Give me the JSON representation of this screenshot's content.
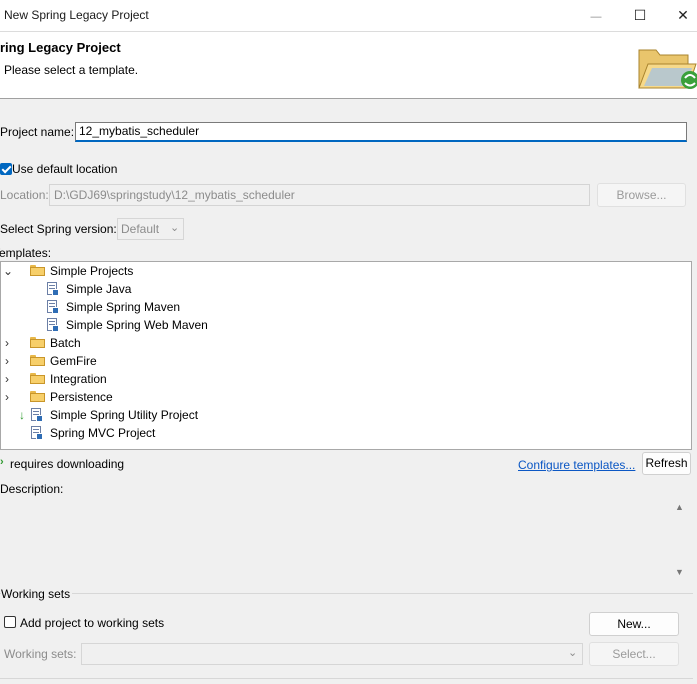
{
  "window": {
    "title": "New Spring Legacy Project",
    "minimize_glyph": "—",
    "maximize_glyph": "☐",
    "close_glyph": "✕"
  },
  "banner": {
    "title": "ring Legacy Project",
    "message": "Please select a template."
  },
  "form": {
    "project_name_label": "Project name:",
    "project_name_value": "12_mybatis_scheduler",
    "use_default_location_label": "Use default location",
    "use_default_location_checked": true,
    "location_label": "Location:",
    "location_value": "D:\\GDJ69\\springstudy\\12_mybatis_scheduler",
    "browse_label": "Browse...",
    "spring_version_label": "Select Spring version:",
    "spring_version_value": "Default",
    "templates_label": "Templates:"
  },
  "templates": {
    "groups": [
      {
        "label": "Simple Projects",
        "expanded": true,
        "icon": "folder-icon"
      },
      {
        "label": "Batch",
        "expanded": false,
        "icon": "folder-icon"
      },
      {
        "label": "GemFire",
        "expanded": false,
        "icon": "folder-icon"
      },
      {
        "label": "Integration",
        "expanded": false,
        "icon": "folder-icon"
      },
      {
        "label": "Persistence",
        "expanded": false,
        "icon": "folder-icon"
      }
    ],
    "children": [
      {
        "label": "Simple Java",
        "icon": "template-icon"
      },
      {
        "label": "Simple Spring Maven",
        "icon": "template-icon"
      },
      {
        "label": "Simple Spring Web Maven",
        "icon": "template-icon"
      }
    ],
    "items": [
      {
        "label": "Simple Spring Utility Project",
        "icon": "template-icon",
        "requires_download": true
      },
      {
        "label": "Spring MVC Project",
        "icon": "template-icon",
        "requires_download": false
      }
    ]
  },
  "footer_info": {
    "requires_downloading_label": "requires downloading",
    "configure_templates_label": "Configure templates...",
    "refresh_label": "Refresh"
  },
  "description": {
    "label": "Description:"
  },
  "working_sets": {
    "group_label": "Working sets",
    "add_label": "Add project to working sets",
    "add_checked": false,
    "new_label": "New...",
    "sets_label": "Working sets:",
    "select_label": "Select..."
  },
  "colors": {
    "accent": "#0067c0",
    "link": "#0b57c4",
    "download_arrow": "#2f9a2f"
  }
}
